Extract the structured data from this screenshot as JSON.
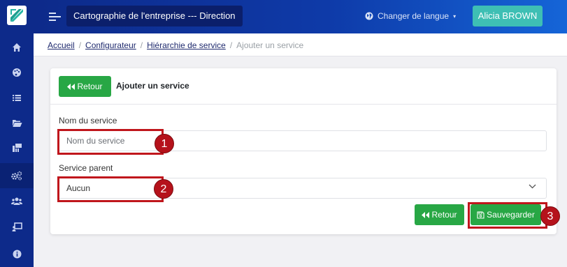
{
  "header": {
    "app_title": "Cartographie de l'entreprise --- Direction",
    "language_label": "Changer de langue",
    "user_name": "Alicia BROWN"
  },
  "sidebar": {
    "items": [
      {
        "icon": "home-icon"
      },
      {
        "icon": "palette-icon"
      },
      {
        "icon": "list-icon"
      },
      {
        "icon": "folder-open-icon"
      },
      {
        "icon": "org-chart-icon"
      },
      {
        "icon": "gears-icon"
      },
      {
        "icon": "users-icon"
      },
      {
        "icon": "presentation-icon"
      },
      {
        "icon": "info-icon"
      }
    ]
  },
  "breadcrumb": {
    "items": [
      "Accueil",
      "Configurateur",
      "Hiérarchie de service"
    ],
    "current": "Ajouter un service"
  },
  "card": {
    "back_label": "Retour",
    "title": "Ajouter un service"
  },
  "form": {
    "name_label": "Nom du service",
    "name_placeholder": "Nom du service",
    "parent_label": "Service parent",
    "parent_value": "Aucun"
  },
  "actions": {
    "back_label": "Retour",
    "save_label": "Sauvegarder"
  },
  "annotations": [
    "1",
    "2",
    "3"
  ],
  "colors": {
    "sidebar": "#0d2a8a",
    "success": "#28a745",
    "user_button": "#3ebfb4",
    "annotation": "#c0161c"
  }
}
